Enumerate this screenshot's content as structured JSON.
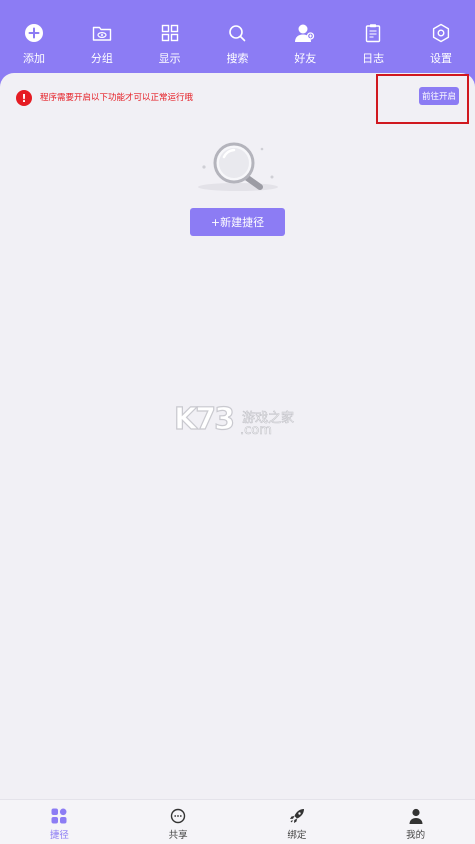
{
  "toolbar": {
    "items": [
      {
        "label": "添加",
        "icon": "plus-circle-icon"
      },
      {
        "label": "分组",
        "icon": "folder-eye-icon"
      },
      {
        "label": "显示",
        "icon": "grid-icon"
      },
      {
        "label": "搜索",
        "icon": "search-icon"
      },
      {
        "label": "好友",
        "icon": "friend-icon"
      },
      {
        "label": "日志",
        "icon": "log-clipboard-icon"
      },
      {
        "label": "设置",
        "icon": "settings-hexagon-icon"
      }
    ]
  },
  "notice": {
    "message": "程序需要开启以下功能才可以正常运行哦",
    "action_label": "前往开启"
  },
  "empty_state": {
    "new_button_label": "+新建捷径"
  },
  "watermark": {
    "big": "K73",
    "cn": "游戏之家",
    "domain": ".com"
  },
  "bottom_nav": {
    "items": [
      {
        "label": "捷径",
        "icon": "shortcut-grid-icon",
        "active": true
      },
      {
        "label": "共享",
        "icon": "share-chat-icon",
        "active": false
      },
      {
        "label": "绑定",
        "icon": "rocket-icon",
        "active": false
      },
      {
        "label": "我的",
        "icon": "user-icon",
        "active": false
      }
    ]
  },
  "colors": {
    "accent": "#8c7cf4",
    "warning": "#e51c23",
    "background": "#f1f0f5"
  }
}
